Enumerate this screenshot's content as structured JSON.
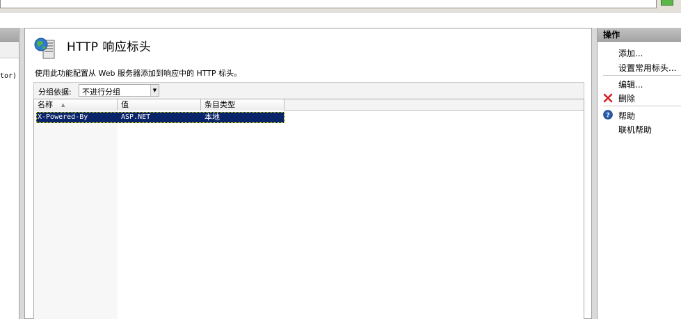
{
  "left_tree": {
    "node_fragment": "tor)"
  },
  "feature": {
    "title": "HTTP  响应标头",
    "description": "使用此功能配置从 Web 服务器添加到响应中的 HTTP 标头。",
    "icon": "globe-server-icon"
  },
  "group": {
    "label": "分组依据:",
    "selected": "不进行分组"
  },
  "grid": {
    "columns": [
      "名称",
      "值",
      "条目类型"
    ],
    "sort_column": "名称",
    "rows": [
      {
        "name": "X-Powered-By",
        "value": "ASP.NET",
        "type": "本地",
        "selected": true
      }
    ]
  },
  "actions": {
    "header": "操作",
    "add": "添加...",
    "set_common": "设置常用标头...",
    "edit": "编辑...",
    "delete": "删除",
    "help": "帮助",
    "online_help": "联机帮助"
  },
  "colors": {
    "selection": "#0a246a",
    "delete_icon": "#d42020",
    "help_icon": "#2a5db0",
    "go_button": "#5bb54a"
  }
}
